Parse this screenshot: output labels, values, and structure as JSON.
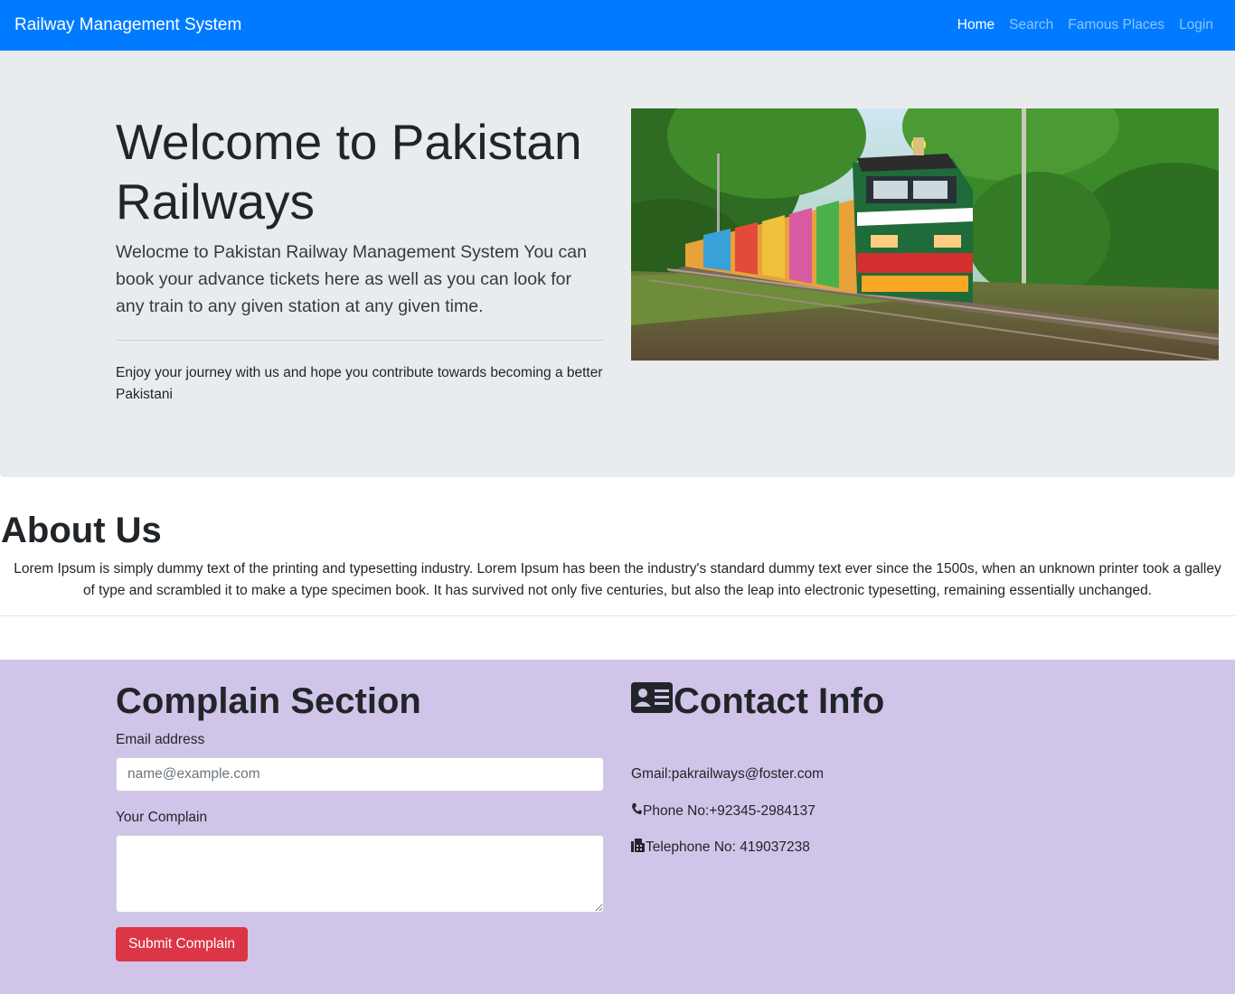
{
  "navbar": {
    "brand": "Railway Management System",
    "links": [
      "Home",
      "Search",
      "Famous Places",
      "Login"
    ],
    "active": "Home"
  },
  "hero": {
    "title": "Welcome to Pakistan Railways",
    "lead": "Welocme to Pakistan Railway Management System You can book your advance tickets here as well as you can look for any train to any given station at any given time.",
    "text": "Enjoy your journey with us and hope you contribute towards becoming a better Pakistani"
  },
  "about": {
    "title": "About Us",
    "text": "Lorem Ipsum is simply dummy text of the printing and typesetting industry. Lorem Ipsum has been the industry's standard dummy text ever since the 1500s, when an unknown printer took a galley of type and scrambled it to make a type specimen book. It has survived not only five centuries, but also the leap into electronic typesetting, remaining essentially unchanged."
  },
  "complain": {
    "title": "Complain Section",
    "email_label": "Email address",
    "email_placeholder": "name@example.com",
    "email_value": "",
    "complain_label": "Your Complain",
    "complain_value": "",
    "submit_label": "Submit Complain"
  },
  "contact": {
    "title": "Contact Info",
    "title_icon": "address-card-icon",
    "gmail": "Gmail:pakrailways@foster.com",
    "phone": "Phone No:+92345-2984137",
    "phone_icon": "phone-icon",
    "telephone": "Telephone No: 419037238",
    "telephone_icon": "fax-icon"
  },
  "colors": {
    "navbar": "#007bff",
    "hero_bg": "#e9ecef",
    "contact_bg": "#d1c4e9",
    "submit": "#dc3545"
  }
}
